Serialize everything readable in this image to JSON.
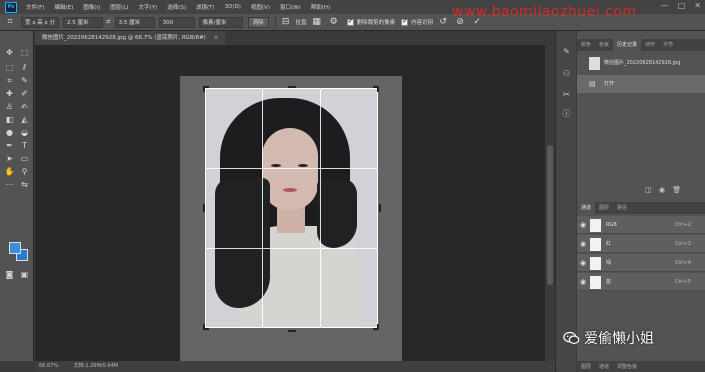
{
  "app": {
    "logo": "Ps"
  },
  "menu": [
    "文件(F)",
    "编辑(E)",
    "图像(I)",
    "图层(L)",
    "文字(Y)",
    "选择(S)",
    "滤镜(T)",
    "3D(D)",
    "视图(V)",
    "窗口(W)",
    "帮助(H)"
  ],
  "window_controls": {
    "minimize": "—",
    "maximize": "□",
    "close": "✕"
  },
  "options": {
    "ratio": "宽 x 高 x 分",
    "width": "2.5 厘米",
    "swap": "⇄",
    "height": "3.5 厘米",
    "resolution": "300",
    "unit": "像素/厘米",
    "clear_label": "清除",
    "straighten_label": "拉直",
    "delete_cropped_label": "删除裁剪的像素",
    "content_aware_label": "内容识别"
  },
  "document": {
    "tab_title": "微信图片_20220628142928.jpg @ 66.7% (蓝底照片, RGB/8#)",
    "tab_close": "×"
  },
  "status": {
    "zoom": "66.67%",
    "doc_info": "文档:1.26M/0.94M"
  },
  "panels": {
    "top_tabs": [
      "颜色",
      "色板",
      "历史记录",
      "动作",
      "字符"
    ],
    "active_top_tab": "历史记录",
    "history": [
      {
        "label": "微信图片_20220628142928.jpg"
      },
      {
        "label": "打开"
      }
    ],
    "layers_tabs": [
      "通道",
      "图层",
      "路径"
    ],
    "active_layers_tab": "通道",
    "channels": [
      {
        "name": "RGB",
        "shortcut": "Ctrl+2"
      },
      {
        "name": "红",
        "shortcut": "Ctrl+3"
      },
      {
        "name": "绿",
        "shortcut": "Ctrl+4"
      },
      {
        "name": "蓝",
        "shortcut": "Ctrl+5"
      }
    ],
    "bottom_tabs": [
      "图层",
      "通道",
      "调整色板"
    ]
  },
  "watermarks": {
    "url": "www.baomilaozhuei.com",
    "brand": "爱偷懒小姐"
  },
  "colors": {
    "foreground": "#3a8ee0",
    "background": "#2f7ad0",
    "url_watermark": "#e62828",
    "accent": "#31a8ff"
  }
}
